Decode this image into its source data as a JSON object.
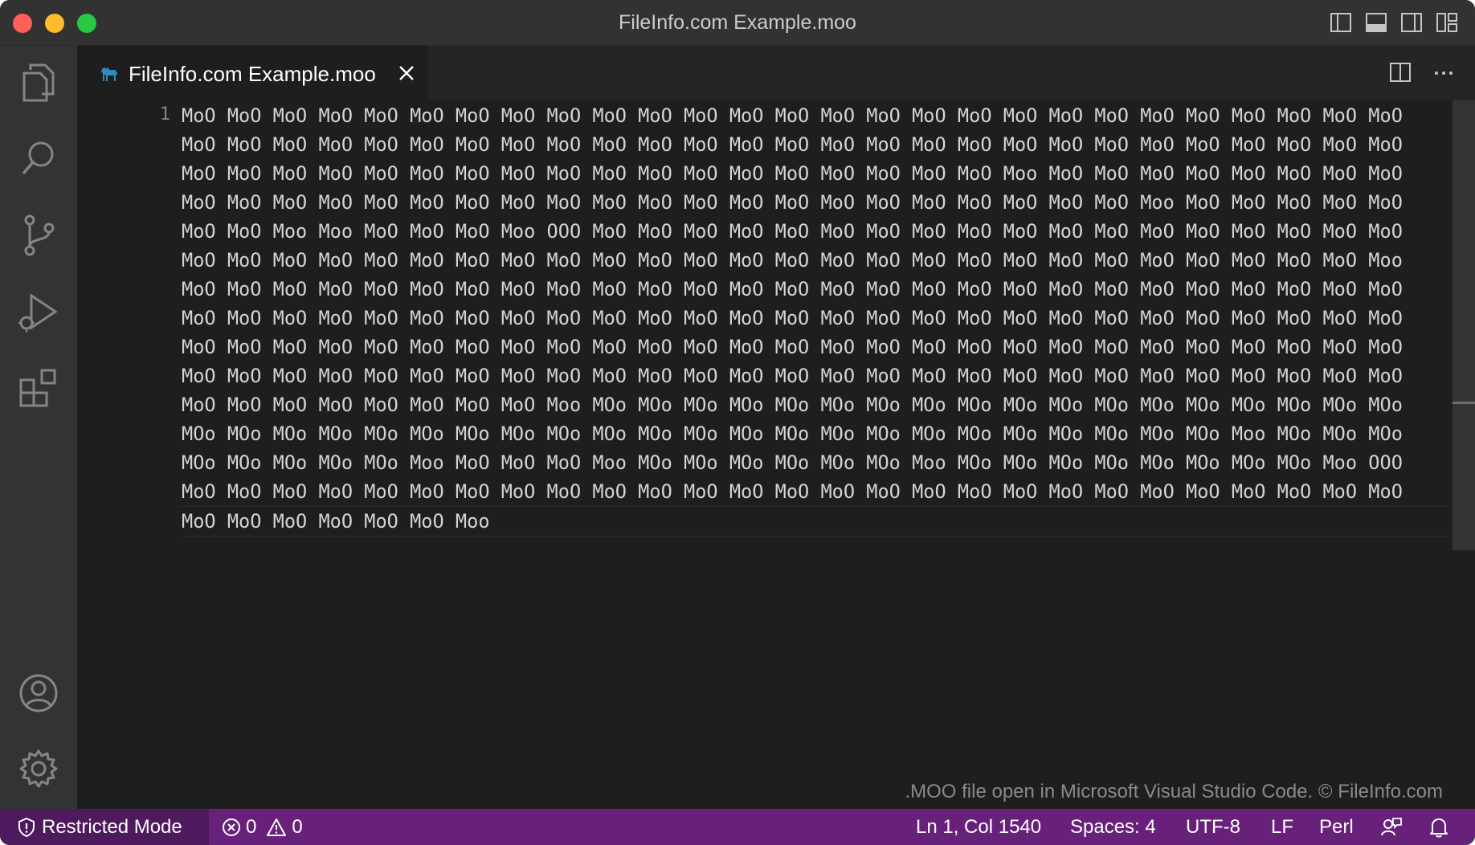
{
  "window": {
    "title": "FileInfo.com Example.moo"
  },
  "tab": {
    "label": "FileInfo.com Example.moo"
  },
  "editor": {
    "line_number": "1",
    "lines": [
      "MoO MoO MoO MoO MoO MoO MoO MoO MoO MoO MoO MoO MoO MoO MoO MoO MoO MoO MoO MoO MoO MoO MoO MoO MoO MoO MoO",
      "MoO MoO MoO MoO MoO MoO MoO MoO MoO MoO MoO MoO MoO MoO MoO MoO MoO MoO MoO MoO MoO MoO MoO MoO MoO MoO MoO",
      "MoO MoO MoO MoO MoO MoO MoO MoO MoO MoO MoO MoO MoO MoO MoO MoO MoO MoO Moo MoO MoO MoO MoO MoO MoO MoO MoO",
      "MoO MoO MoO MoO MoO MoO MoO MoO MoO MoO MoO MoO MoO MoO MoO MoO MoO MoO MoO MoO MoO Moo MoO MoO MoO MoO MoO",
      "MoO MoO Moo Moo MoO MoO MoO Moo OOO MoO MoO MoO MoO MoO MoO MoO MoO MoO MoO MoO MoO MoO MoO MoO MoO MoO MoO",
      "MoO MoO MoO MoO MoO MoO MoO MoO MoO MoO MoO MoO MoO MoO MoO MoO MoO MoO MoO MoO MoO MoO MoO MoO MoO MoO Moo",
      "MoO MoO MoO MoO MoO MoO MoO MoO MoO MoO MoO MoO MoO MoO MoO MoO MoO MoO MoO MoO MoO MoO MoO MoO MoO MoO MoO",
      "MoO MoO MoO MoO MoO MoO MoO MoO MoO MoO MoO MoO MoO MoO MoO MoO MoO MoO MoO MoO MoO MoO MoO MoO MoO MoO MoO",
      "MoO MoO MoO MoO MoO MoO MoO MoO MoO MoO MoO MoO MoO MoO MoO MoO MoO MoO MoO MoO MoO MoO MoO MoO MoO MoO MoO",
      "MoO MoO MoO MoO MoO MoO MoO MoO MoO MoO MoO MoO MoO MoO MoO MoO MoO MoO MoO MoO MoO MoO MoO MoO MoO MoO MoO",
      "MoO MoO MoO MoO MoO MoO MoO MoO Moo MOo MOo MOo MOo MOo MOo MOo MOo MOo MOo MOo MOo MOo MOo MOo MOo MOo MOo",
      "MOo MOo MOo MOo MOo MOo MOo MOo MOo MOo MOo MOo MOo MOo MOo MOo MOo MOo MOo MOo MOo MOo MOo Moo MOo MOo MOo",
      "MOo MOo MOo MOo MOo Moo MoO MoO MoO Moo MOo MOo MOo MOo MOo MOo Moo MOo MOo MOo MOo MOo MOo MOo MOo Moo OOO",
      "MoO MoO MoO MoO MoO MoO MoO MoO MoO MoO MoO MoO MoO MoO MoO MoO MoO MoO MoO MoO MoO MoO MoO MoO MoO MoO MoO",
      "MoO MoO MoO MoO MoO MoO Moo"
    ]
  },
  "watermark": ".MOO file open in Microsoft Visual Studio Code. © FileInfo.com",
  "status": {
    "restricted": "Restricted Mode",
    "errors": "0",
    "warnings": "0",
    "position": "Ln 1, Col 1540",
    "spaces": "Spaces: 4",
    "encoding": "UTF-8",
    "eol": "LF",
    "language": "Perl"
  },
  "icons": {
    "explorer": "files-icon",
    "search": "search-icon",
    "scm": "source-control-icon",
    "debug": "run-debug-icon",
    "extensions": "extensions-icon",
    "accounts": "account-icon",
    "manage": "gear-icon",
    "tab_file": "camel-file-icon",
    "close": "close-icon",
    "split": "split-editor-icon",
    "more": "more-actions-icon"
  },
  "colors": {
    "status_bar": "#68217a",
    "restricted_bg": "#4e1a5d",
    "editor_bg": "#1e1e1e"
  }
}
